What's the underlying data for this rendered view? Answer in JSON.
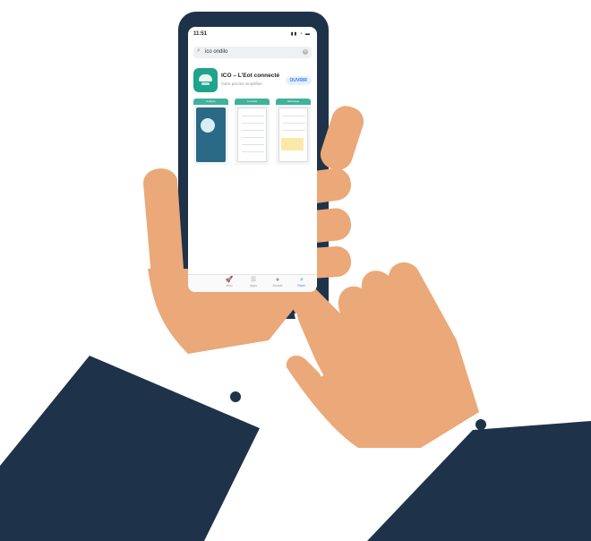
{
  "colors": {
    "background": "#ffffff",
    "sleeve": "#1e3349",
    "skin": "#eba878",
    "phone_frame": "#1e3349",
    "app_accent": "#1fa38c",
    "get_button_text": "#3478f6"
  },
  "phone": {
    "status_time": "11:51",
    "search_query": "ico ondilo",
    "app": {
      "name": "ICO – L'Eot connecté",
      "subtitle": "Votre piscine simplifiée",
      "get_label": "OUVRIR",
      "icon": "ico-dome-icon"
    },
    "screenshots": [
      {
        "caption": "Analyse"
      },
      {
        "caption": "Conseils"
      },
      {
        "caption": "Historique"
      }
    ],
    "tabbar": [
      {
        "label": "Jeux",
        "icon": "rocket-icon",
        "glyph": "🚀",
        "active": false
      },
      {
        "label": "Apps",
        "icon": "layers-icon",
        "glyph": "☰",
        "active": false
      },
      {
        "label": "Arcade",
        "icon": "arcade-icon",
        "glyph": "●",
        "active": false
      },
      {
        "label": "Rech.",
        "icon": "search-icon",
        "glyph": "⌕",
        "active": true
      }
    ]
  }
}
